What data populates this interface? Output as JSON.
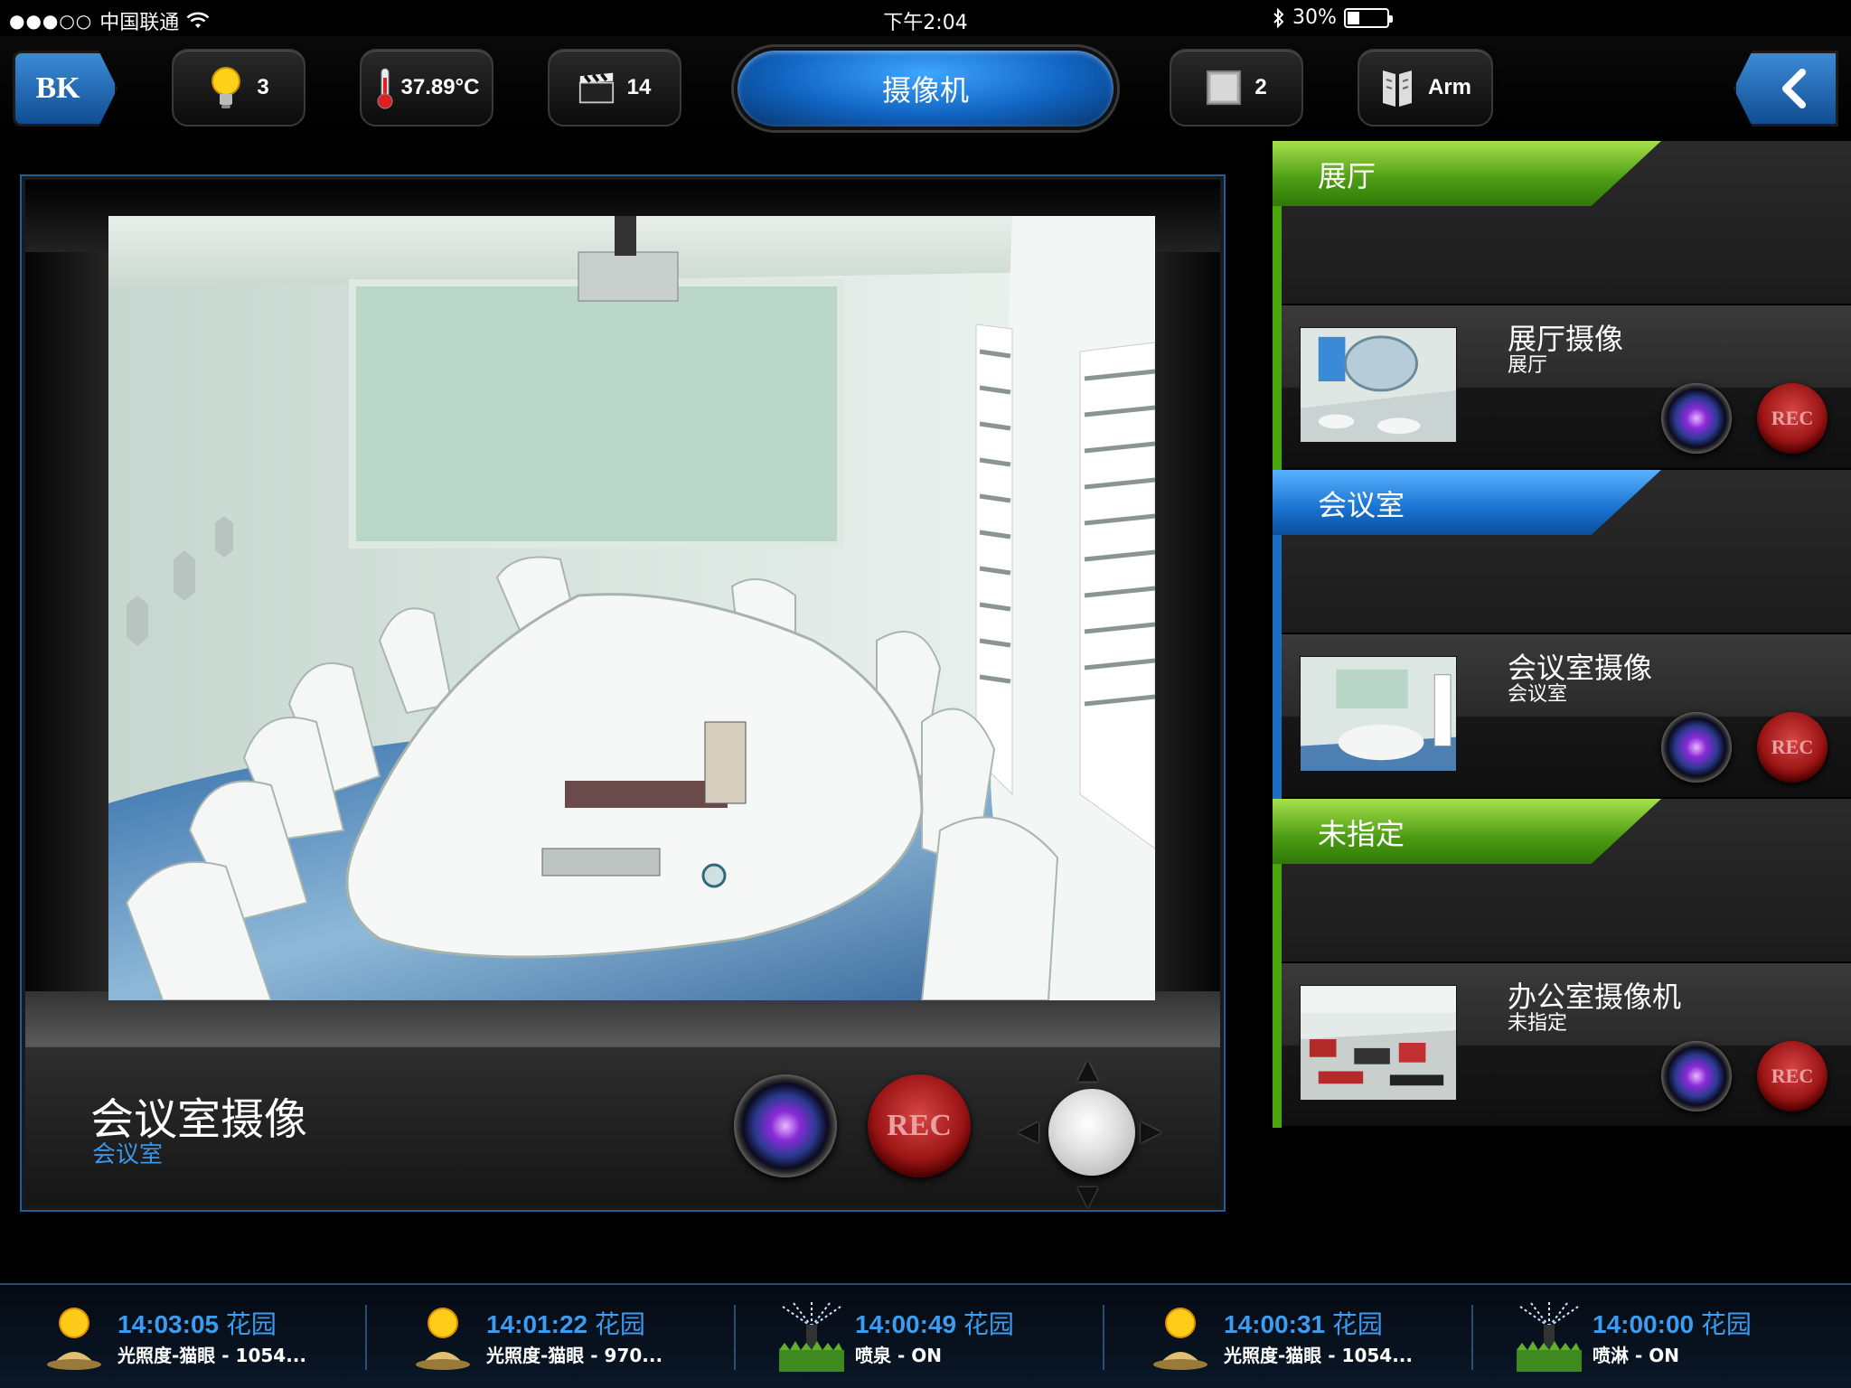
{
  "status_bar": {
    "signal": "●●●○○",
    "carrier": "中国联通",
    "time": "下午2:04",
    "battery": "30%",
    "battery_level": 0.3
  },
  "top_nav": {
    "logo": "BK",
    "lights_count": "3",
    "temperature": "37.89°C",
    "scenes_count": "14",
    "title": "摄像机",
    "shades_count": "2",
    "security_state": "Arm"
  },
  "viewer": {
    "camera_name": "会议室摄像",
    "camera_room": "会议室",
    "rec_label": "REC"
  },
  "camera_groups": [
    {
      "name": "展厅",
      "color": "green",
      "cameras": [
        {
          "name": "展厅摄像",
          "room": "展厅",
          "rec_label": "REC"
        }
      ]
    },
    {
      "name": "会议室",
      "color": "blue",
      "cameras": [
        {
          "name": "会议室摄像",
          "room": "会议室",
          "rec_label": "REC"
        }
      ]
    },
    {
      "name": "未指定",
      "color": "green",
      "cameras": [
        {
          "name": "办公室摄像机",
          "room": "未指定",
          "rec_label": "REC"
        }
      ]
    }
  ],
  "events": [
    {
      "time": "14:03:05",
      "location": "花园",
      "desc_name": "光照度-猫眼",
      "desc_value": " - 1054...",
      "icon": "sun-lamp-icon"
    },
    {
      "time": "14:01:22",
      "location": "花园",
      "desc_name": "光照度-猫眼",
      "desc_value": " - 970...",
      "icon": "sun-lamp-icon"
    },
    {
      "time": "14:00:49",
      "location": "花园",
      "desc_name": "喷泉",
      "desc_value": " - ON",
      "icon": "sprinkler-icon"
    },
    {
      "time": "14:00:31",
      "location": "花园",
      "desc_name": "光照度-猫眼",
      "desc_value": " - 1054...",
      "icon": "sun-lamp-icon"
    },
    {
      "time": "14:00:00",
      "location": "花园",
      "desc_name": "喷淋",
      "desc_value": " - ON",
      "icon": "sprinkler-icon"
    }
  ],
  "colors": {
    "accent_blue": "#3b9cf0",
    "group_green": "#49a60f",
    "group_blue": "#1a6fc2",
    "rec_red": "#9b1515"
  }
}
